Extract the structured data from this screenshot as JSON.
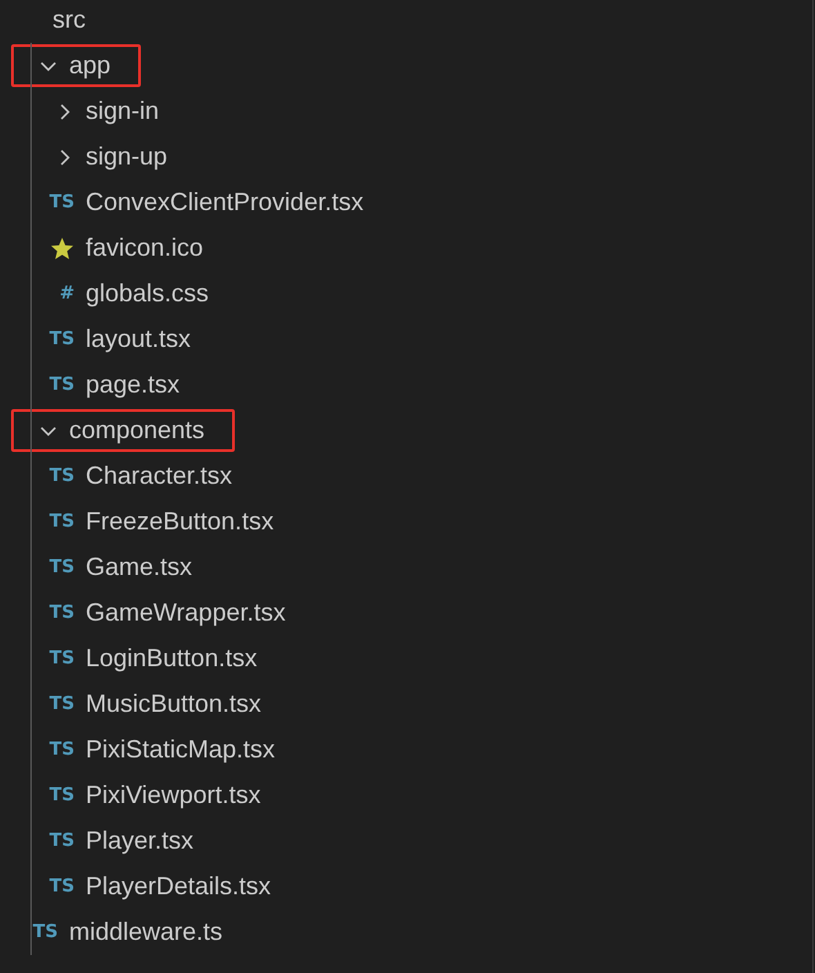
{
  "explorer": {
    "tree": [
      {
        "name": "src",
        "children": [
          {
            "name": "app",
            "kind": "folder",
            "expanded": true,
            "highlighted": true,
            "children": [
              {
                "name": "sign-in",
                "kind": "folder",
                "expanded": false,
                "highlighted": false
              },
              {
                "name": "sign-up",
                "kind": "folder",
                "expanded": false,
                "highlighted": false
              },
              {
                "name": "ConvexClientProvider.tsx",
                "kind": "file",
                "badge": "TS"
              },
              {
                "name": "favicon.ico",
                "kind": "image"
              },
              {
                "name": "globals.css",
                "kind": "file",
                "badge": "#"
              },
              {
                "name": "layout.tsx",
                "kind": "file",
                "badge": "TS"
              },
              {
                "name": "page.tsx",
                "kind": "file",
                "badge": "TS"
              }
            ]
          },
          {
            "name": "components",
            "kind": "folder",
            "expanded": true,
            "highlighted": true,
            "children": [
              {
                "name": "Character.tsx",
                "kind": "file",
                "badge": "TS"
              },
              {
                "name": "FreezeButton.tsx",
                "kind": "file",
                "badge": "TS"
              },
              {
                "name": "Game.tsx",
                "kind": "file",
                "badge": "TS"
              },
              {
                "name": "GameWrapper.tsx",
                "kind": "file",
                "badge": "TS"
              },
              {
                "name": "LoginButton.tsx",
                "kind": "file",
                "badge": "TS"
              },
              {
                "name": "MusicButton.tsx",
                "kind": "file",
                "badge": "TS"
              },
              {
                "name": "PixiStaticMap.tsx",
                "kind": "file",
                "badge": "TS"
              },
              {
                "name": "PixiViewport.tsx",
                "kind": "file",
                "badge": "TS"
              },
              {
                "name": "Player.tsx",
                "kind": "file",
                "badge": "TS"
              },
              {
                "name": "PlayerDetails.tsx",
                "kind": "file",
                "badge": "TS"
              }
            ]
          },
          {
            "name": "middleware.ts",
            "kind": "file",
            "badge": "TS"
          }
        ]
      }
    ]
  }
}
